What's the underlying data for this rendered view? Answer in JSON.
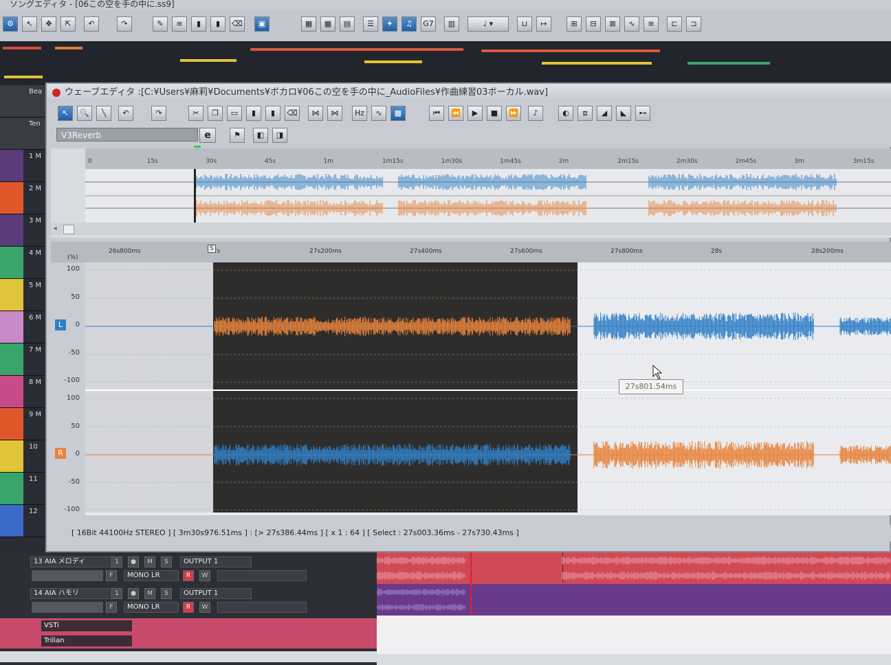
{
  "song_editor": {
    "title": "ソングエディタ - [06この空を手の中に.ss9]",
    "tracks": [
      {
        "num": "Bea",
        "color": "#3a3c44"
      },
      {
        "num": "Ten",
        "color": "#3a3c44"
      },
      {
        "num": "1 M",
        "color": "#5a3c7a"
      },
      {
        "num": "2 M",
        "color": "#e0582a"
      },
      {
        "num": "3 M",
        "color": "#5a3c7a"
      },
      {
        "num": "4 M",
        "color": "#3aa56a"
      },
      {
        "num": "5 M",
        "color": "#e0c43a"
      },
      {
        "num": "6 M",
        "color": "#c88ac8"
      },
      {
        "num": "7 M",
        "color": "#3aa56a"
      },
      {
        "num": "8 M",
        "color": "#c84a8a"
      },
      {
        "num": "9 M",
        "color": "#e0582a"
      },
      {
        "num": "10",
        "color": "#e0c43a"
      },
      {
        "num": "11",
        "color": "#3aa56a"
      },
      {
        "num": "12",
        "color": "#3a6ac8"
      }
    ]
  },
  "wave_editor": {
    "title": "ウェーブエディタ  :[C:¥Users¥麻莉¥Documents¥ボカロ¥06この空を手の中に_AudioFiles¥作曲練習03ボーカル.wav]",
    "effect": "V3Reverb",
    "effect_edit": "e",
    "overview_ticks": [
      "0",
      "15s",
      "30s",
      "45s",
      "1m",
      "1m15s",
      "1m30s",
      "1m45s",
      "2m",
      "2m15s",
      "2m30s",
      "2m45s",
      "3m",
      "3m15s"
    ],
    "detail_ticks": [
      "26s800ms",
      "27s",
      "27s200ms",
      "27s400ms",
      "27s600ms",
      "27s800ms",
      "28s",
      "28s200ms"
    ],
    "y_unit": "(%)",
    "y_labels_L": [
      "100",
      "50",
      "0",
      "-50",
      "-100"
    ],
    "y_labels_R": [
      "100",
      "50",
      "0",
      "-50",
      "-100"
    ],
    "channel_L": "L",
    "channel_R": "R",
    "marker": "S",
    "tooltip": "27s801.54ms",
    "status": "[ 16Bit   44100Hz   STEREO ]  [ 3m30s976.51ms ] : [> 27s386.44ms ]  [ x 1 : 64 ]  [ Select : 27s003.36ms - 27s730.43ms ]",
    "colors": {
      "left": "#2f7fc6",
      "right": "#e8823a",
      "selection": "#2f2d2b"
    }
  },
  "bottom_tracks": [
    {
      "name": "13 AIA メロディ",
      "num": "1",
      "output": "OUTPUT 1",
      "mode": "MONO LR",
      "rec": "R",
      "write": "W"
    },
    {
      "name": "14 AIA ハモリ",
      "num": "1",
      "output": "OUTPUT 1",
      "mode": "MONO LR",
      "rec": "R",
      "write": "W"
    }
  ],
  "bus_labels": [
    "VSTi",
    "Trilian"
  ],
  "mute_labels": {
    "m": "M",
    "s": "S",
    "f": "F"
  }
}
